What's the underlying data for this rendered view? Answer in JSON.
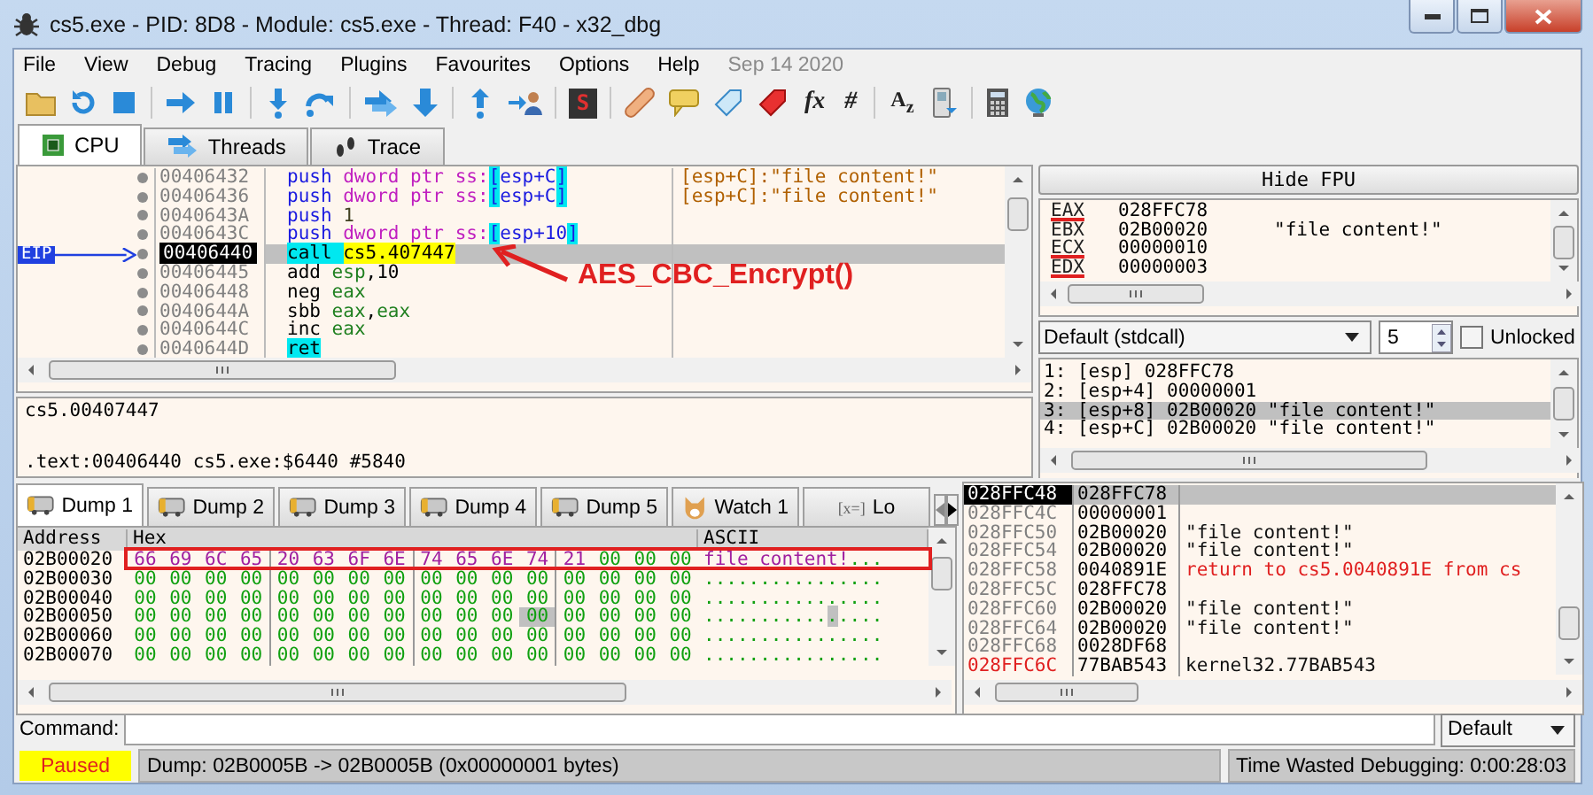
{
  "window": {
    "title": "cs5.exe - PID: 8D8 - Module: cs5.exe - Thread: F40 - x32_dbg"
  },
  "menu": [
    "File",
    "View",
    "Debug",
    "Tracing",
    "Plugins",
    "Favourites",
    "Options",
    "Help"
  ],
  "build_date": "Sep 14 2020",
  "toolbar": {
    "script_glyph": "S",
    "glyph_buttons": [
      "fx",
      "#"
    ],
    "font_glyph": "A$_{z}$"
  },
  "tabs": [
    {
      "label": "CPU",
      "selected": true
    },
    {
      "label": "Threads",
      "selected": false
    },
    {
      "label": "Trace",
      "selected": false
    }
  ],
  "disassembly": {
    "eip_label": "EIP",
    "annotation": "AES_CBC_Encrypt()",
    "rows": [
      {
        "address": "00406432",
        "selected": false,
        "eip": false,
        "instruction": [
          {
            "t": "push ",
            "kind": "mnemonic"
          },
          {
            "t": "dword ptr ss:",
            "kind": "size"
          },
          {
            "t": "[",
            "kind": "bracket"
          },
          {
            "t": "esp+C",
            "kind": "mnemonic"
          },
          {
            "t": "]",
            "kind": "bracket"
          }
        ],
        "comment": "[esp+C]:\"file content!\""
      },
      {
        "address": "00406436",
        "selected": false,
        "eip": false,
        "instruction": [
          {
            "t": "push ",
            "kind": "mnemonic"
          },
          {
            "t": "dword ptr ss:",
            "kind": "size"
          },
          {
            "t": "[",
            "kind": "bracket"
          },
          {
            "t": "esp+C",
            "kind": "mnemonic"
          },
          {
            "t": "]",
            "kind": "bracket"
          }
        ],
        "comment": "[esp+C]:\"file content!\""
      },
      {
        "address": "0040643A",
        "selected": false,
        "eip": false,
        "instruction": [
          {
            "t": "push ",
            "kind": "mnemonic"
          },
          {
            "t": "1",
            "kind": "number"
          }
        ]
      },
      {
        "address": "0040643C",
        "selected": false,
        "eip": false,
        "instruction": [
          {
            "t": "push ",
            "kind": "mnemonic"
          },
          {
            "t": "dword ptr ss:",
            "kind": "size"
          },
          {
            "t": "[",
            "kind": "bracket"
          },
          {
            "t": "esp+10",
            "kind": "mnemonic"
          },
          {
            "t": "]",
            "kind": "bracket"
          }
        ]
      },
      {
        "address": "00406440",
        "selected": true,
        "eip": true,
        "instruction": [
          {
            "t": "call ",
            "kind": "call"
          },
          {
            "t": "cs5.407447",
            "kind": "target"
          }
        ]
      },
      {
        "address": "00406445",
        "selected": false,
        "eip": false,
        "instruction": [
          {
            "t": "add ",
            "kind": "plain"
          },
          {
            "t": "esp",
            "kind": "register"
          },
          {
            "t": ",10",
            "kind": "plain"
          }
        ]
      },
      {
        "address": "00406448",
        "selected": false,
        "eip": false,
        "instruction": [
          {
            "t": "neg ",
            "kind": "plain"
          },
          {
            "t": "eax",
            "kind": "register"
          }
        ]
      },
      {
        "address": "0040644A",
        "selected": false,
        "eip": false,
        "instruction": [
          {
            "t": "sbb ",
            "kind": "plain"
          },
          {
            "t": "eax",
            "kind": "register"
          },
          {
            "t": ",",
            "kind": "plain"
          },
          {
            "t": "eax",
            "kind": "register"
          }
        ]
      },
      {
        "address": "0040644C",
        "selected": false,
        "eip": false,
        "instruction": [
          {
            "t": "inc ",
            "kind": "plain"
          },
          {
            "t": "eax",
            "kind": "register"
          }
        ]
      },
      {
        "address": "0040644D",
        "selected": false,
        "eip": false,
        "instruction": [
          {
            "t": "ret",
            "kind": "call"
          }
        ]
      }
    ]
  },
  "info": [
    "cs5.00407447",
    ".text:00406440 cs5.exe:$6440 #5840"
  ],
  "registers": {
    "button": "Hide FPU",
    "rows": [
      {
        "name": "EAX",
        "value": "028FFC78",
        "modified": true
      },
      {
        "name": "EBX",
        "value": "02B00020",
        "comment": "\"file content!\"",
        "modified": false
      },
      {
        "name": "ECX",
        "value": "00000010",
        "modified": true
      },
      {
        "name": "EDX",
        "value": "00000003",
        "modified": true
      }
    ]
  },
  "call_convention": {
    "value": "Default (stdcall)",
    "count": "5",
    "unlocked_label": "Unlocked",
    "unlocked": false
  },
  "arguments": [
    {
      "text": "1: [esp] 028FFC78",
      "selected": false
    },
    {
      "text": "2: [esp+4] 00000001",
      "selected": false
    },
    {
      "text": "3: [esp+8] 02B00020 \"file content!\"",
      "selected": true
    },
    {
      "text": "4: [esp+C] 02B00020 \"file content!\"",
      "selected": false
    }
  ],
  "dump": {
    "tabs": [
      {
        "label": "Dump 1",
        "kind": "dump",
        "selected": true
      },
      {
        "label": "Dump 2",
        "kind": "dump",
        "selected": false
      },
      {
        "label": "Dump 3",
        "kind": "dump",
        "selected": false
      },
      {
        "label": "Dump 4",
        "kind": "dump",
        "selected": false
      },
      {
        "label": "Dump 5",
        "kind": "dump",
        "selected": false
      },
      {
        "label": "Watch 1",
        "kind": "watch",
        "selected": false
      },
      {
        "label": "Lo",
        "kind": "locals",
        "icon_text": "[x=]",
        "selected": false
      }
    ],
    "columns": [
      "Address",
      "Hex",
      "ASCII"
    ],
    "rows": [
      {
        "address": "02B00020",
        "boxed": true,
        "hex": [
          {
            "t": "66 69 6C 65 20 63 6F 6E 74 65 6E 74 21",
            "kind": "data"
          },
          {
            "t": "00 00 00",
            "kind": "zero"
          }
        ],
        "ascii": [
          {
            "t": "file content!",
            "kind": "data"
          },
          {
            "t": "...",
            "kind": "zero"
          }
        ]
      },
      {
        "address": "02B00030",
        "boxed": false,
        "hex": [
          {
            "t": "00 00 00 00 00 00 00 00 00 00 00 00 00 00 00 00",
            "kind": "zero"
          }
        ],
        "ascii": [
          {
            "t": "................",
            "kind": "zero"
          }
        ]
      },
      {
        "address": "02B00040",
        "boxed": false,
        "hex": [
          {
            "t": "00 00 00 00 00 00 00 00 00 00 00 00 00 00 00 00",
            "kind": "zero"
          }
        ],
        "ascii": [
          {
            "t": "................",
            "kind": "zero"
          }
        ]
      },
      {
        "address": "02B00050",
        "boxed": false,
        "hex": [
          {
            "t": "00 00 00 00 00 00 00 00 00 00 00",
            "kind": "zero"
          },
          {
            "t": "00",
            "kind": "cursor"
          },
          {
            "t": "00 00 00 00",
            "kind": "zero"
          }
        ],
        "ascii": [
          {
            "t": "...........",
            "kind": "zero"
          },
          {
            "t": ".",
            "kind": "cursor"
          },
          {
            "t": "....",
            "kind": "zero"
          }
        ]
      },
      {
        "address": "02B00060",
        "boxed": false,
        "hex": [
          {
            "t": "00 00 00 00 00 00 00 00 00 00 00 00 00 00 00 00",
            "kind": "zero"
          }
        ],
        "ascii": [
          {
            "t": "................",
            "kind": "zero"
          }
        ]
      },
      {
        "address": "02B00070",
        "boxed": false,
        "hex": [
          {
            "t": "00 00 00 00 00 00 00 00 00 00 00 00 00 00 00 00",
            "kind": "zero"
          }
        ],
        "ascii": [
          {
            "t": "................",
            "kind": "zero"
          }
        ]
      }
    ]
  },
  "stack": [
    {
      "address": "028FFC48",
      "value": "028FFC78",
      "selected": true,
      "marked": false
    },
    {
      "address": "028FFC4C",
      "value": "00000001",
      "selected": false,
      "marked": false
    },
    {
      "address": "028FFC50",
      "value": "02B00020",
      "comment": "\"file content!\"",
      "kind": "text",
      "selected": false,
      "marked": false
    },
    {
      "address": "028FFC54",
      "value": "02B00020",
      "comment": "\"file content!\"",
      "kind": "text",
      "selected": false,
      "marked": false
    },
    {
      "address": "028FFC58",
      "value": "0040891E",
      "comment": "return to cs5.0040891E from cs",
      "kind": "return",
      "selected": false,
      "marked": false
    },
    {
      "address": "028FFC5C",
      "value": "028FFC78",
      "selected": false,
      "marked": false
    },
    {
      "address": "028FFC60",
      "value": "02B00020",
      "comment": "\"file content!\"",
      "kind": "text",
      "selected": false,
      "marked": false
    },
    {
      "address": "028FFC64",
      "value": "02B00020",
      "comment": "\"file content!\"",
      "kind": "text",
      "selected": false,
      "marked": false
    },
    {
      "address": "028FFC68",
      "value": "0028DF68",
      "selected": false,
      "marked": false
    },
    {
      "address": "028FFC6C",
      "value": "77BAB543",
      "comment": "kernel32.77BAB543",
      "kind": "text",
      "selected": false,
      "marked": true
    }
  ],
  "command": {
    "label": "Command:",
    "mode": "Default"
  },
  "status": {
    "state": "Paused",
    "message": "Dump: 02B0005B -> 02B0005B (0x00000001 bytes)",
    "time": "Time Wasted Debugging: 0:00:28:03"
  }
}
